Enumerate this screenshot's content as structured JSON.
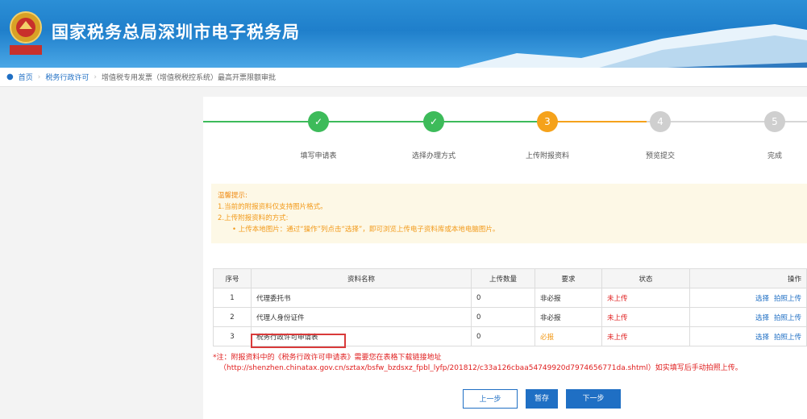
{
  "header": {
    "title": "国家税务总局深圳市电子税务局",
    "emblem_text": "中国税务"
  },
  "breadcrumb": {
    "home": "首页",
    "level1": "税务行政许可",
    "level2": "增值税专用发票（增值税税控系统）最高开票限额审批"
  },
  "steps": [
    {
      "label": "填写申请表",
      "num": "✓",
      "state": "done"
    },
    {
      "label": "选择办理方式",
      "num": "✓",
      "state": "done"
    },
    {
      "label": "上传附报资料",
      "num": "3",
      "state": "current"
    },
    {
      "label": "预览提交",
      "num": "4",
      "state": "todo"
    },
    {
      "label": "完成",
      "num": "5",
      "state": "todo"
    }
  ],
  "notice": {
    "title": "温馨提示:",
    "line1": "1.当前的附报资料仅支持图片格式。",
    "line2": "2.上传附报资料的方式:",
    "line3": "• 上传本地图片：通过“操作”列点击“选择”，即可浏览上传电子资料库或本地电脑图片。"
  },
  "table": {
    "headers": [
      "序号",
      "资料名称",
      "上传数量",
      "要求",
      "状态",
      "操作"
    ],
    "rows": [
      {
        "no": "1",
        "name": "代理委托书",
        "count": "0",
        "req": "非必报",
        "status": "未上传",
        "select": "选择",
        "photo": "拍照上传"
      },
      {
        "no": "2",
        "name": "代理人身份证件",
        "count": "0",
        "req": "非必报",
        "status": "未上传",
        "select": "选择",
        "photo": "拍照上传"
      },
      {
        "no": "3",
        "name": "税务行政许可申请表",
        "count": "0",
        "req": "必报",
        "status": "未上传",
        "select": "选择",
        "photo": "拍照上传"
      }
    ]
  },
  "footnote": {
    "line1": "*注：附报资料中的《税务行政许可申请表》需要您在表格下载链接地址",
    "line2": "（http://shenzhen.chinatax.gov.cn/sztax/bsfw_bzdsxz_fpbl_lyfp/201812/c33a126cbaa54749920d7974656771da.shtml）如实填写后手动拍照上传。"
  },
  "buttons": {
    "prev": "上一步",
    "save": "暂存",
    "next": "下一步"
  },
  "colors": {
    "accent": "#1f6fc4",
    "done": "#3dbb5a",
    "current": "#f5a21b",
    "todo": "#cfcfcf",
    "warn": "#e02020"
  }
}
